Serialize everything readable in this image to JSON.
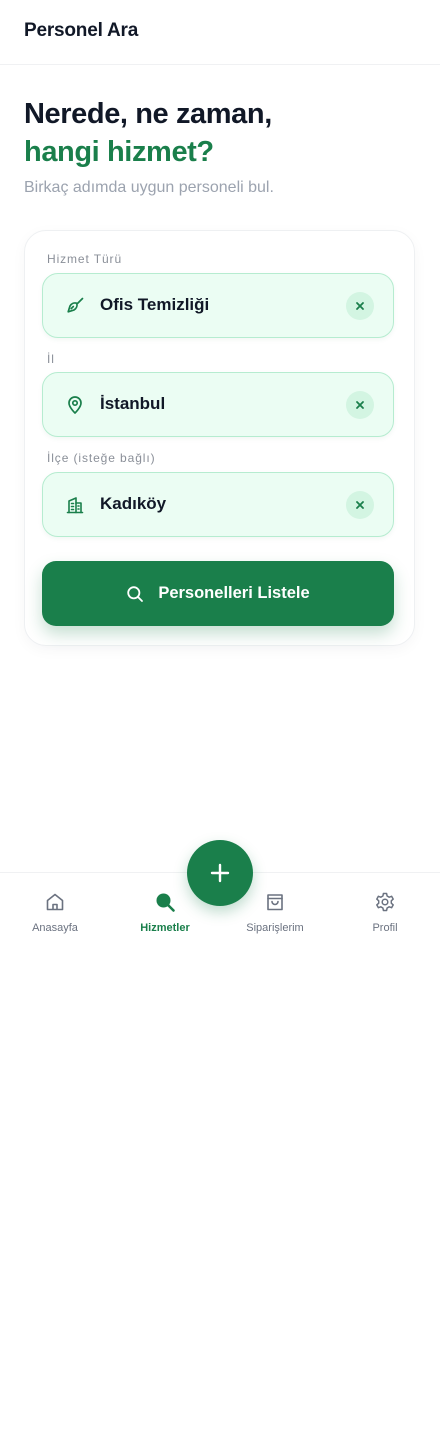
{
  "header": {
    "title": "Personel Ara"
  },
  "hero": {
    "line1": "Nerede, ne zaman,",
    "line2": "hangi hizmet?",
    "subtitle": "Birkaç adımda uygun personeli bul."
  },
  "form": {
    "service": {
      "label": "Hizmet Türü",
      "value": "Ofis Temizliği",
      "icon": "broom-icon"
    },
    "city": {
      "label": "İl",
      "value": "İstanbul",
      "icon": "map-pin-icon"
    },
    "district": {
      "label": "İlçe (isteğe bağlı)",
      "value": "Kadıköy",
      "icon": "building-icon"
    },
    "submit_label": "Personelleri Listele"
  },
  "nav": {
    "items": [
      {
        "label": "Anasayfa",
        "icon": "home-icon",
        "active": false
      },
      {
        "label": "Hizmetler",
        "icon": "search-icon",
        "active": true
      },
      {
        "label": "Siparişlerim",
        "icon": "shopping-bag-icon",
        "active": false
      },
      {
        "label": "Profil",
        "icon": "gear-icon",
        "active": false
      }
    ]
  },
  "colors": {
    "accent": "#1a7f4b",
    "field_bg": "#ebfdf3",
    "field_border": "#b6ecd0",
    "muted_text": "#9ca3af"
  }
}
